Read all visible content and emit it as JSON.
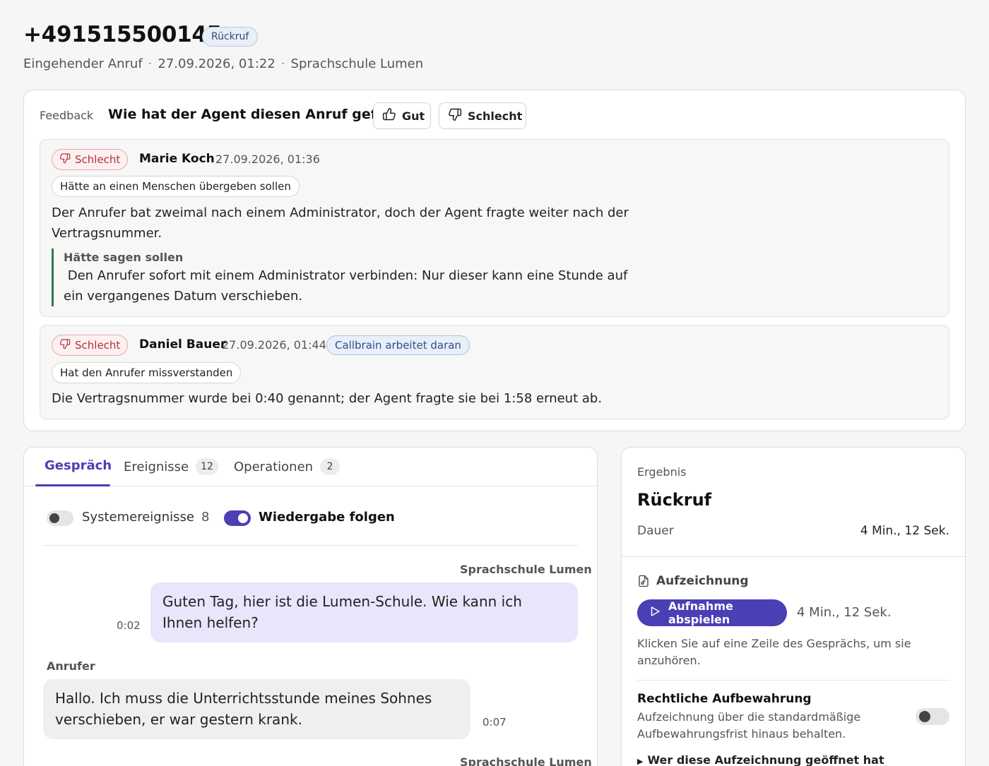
{
  "header": {
    "phone": "+491515500145",
    "badge": "Rückruf",
    "direction": "Eingehender Anruf",
    "datetime": "27.09.2026, 01:22",
    "org": "Sprachschule Lumen"
  },
  "feedback": {
    "label": "Feedback",
    "question": "Wie hat der Agent diesen Anruf geführt?",
    "good_label": "Gut",
    "bad_label": "Schlecht",
    "entries": [
      {
        "rating": "Schlecht",
        "author": "Marie Koch",
        "timestamp": "27.09.2026, 01:36",
        "tag": "Hätte an einen Menschen übergeben sollen",
        "text": "Der Anrufer bat zweimal nach einem Administrator, doch der Agent fragte weiter nach der Vertragsnummer.",
        "should_have_label": "Hätte sagen sollen",
        "should_have_text": " Den Anrufer sofort mit einem Administrator verbinden: Nur dieser kann eine Stunde auf ein vergangenes Datum verschieben."
      },
      {
        "rating": "Schlecht",
        "author": "Daniel Bauer",
        "timestamp": "27.09.2026, 01:44",
        "status": "Callbrain arbeitet daran",
        "tag": "Hat den Anrufer missverstanden",
        "text": "Die Vertragsnummer wurde bei 0:40 genannt; der Agent fragte sie bei 1:58 erneut ab."
      }
    ]
  },
  "conversation": {
    "tabs": [
      {
        "label": "Gespräch",
        "count": ""
      },
      {
        "label": "Ereignisse",
        "count": "12"
      },
      {
        "label": "Operationen",
        "count": "2"
      }
    ],
    "system_events_label": "Systemereignisse",
    "system_events_count": "8",
    "system_events_on": false,
    "follow_playback_label": "Wiedergabe folgen",
    "follow_playback_on": true,
    "messages": [
      {
        "speaker": "Sprachschule Lumen",
        "time": "0:02",
        "text": "Guten Tag, hier ist die Lumen-Schule. Wie kann ich Ihnen helfen?"
      },
      {
        "speaker": "Anrufer",
        "time": "0:07",
        "text": "Hallo. Ich muss die Unterrichtsstunde meines Sohnes verschieben, er war gestern krank."
      },
      {
        "speaker": "Sprachschule Lumen"
      }
    ]
  },
  "result": {
    "label": "Ergebnis",
    "title": "Rückruf",
    "duration_label": "Dauer",
    "duration_value": "4 Min., 12 Sek.",
    "recording_label": "Aufzeichnung",
    "play_label": "Aufnahme abspielen",
    "recording_length": "4 Min., 12 Sek.",
    "hint": "Klicken Sie auf eine Zeile des Gesprächs, um sie anzuhören.",
    "legal_title": "Rechtliche Aufbewahrung",
    "legal_desc": "Aufzeichnung über die standardmäßige Aufbewahrungsfrist hinaus behalten.",
    "legal_on": false,
    "details_label": "Wer diese Aufzeichnung geöffnet hat"
  },
  "colors": {
    "accent": "#4a3fb5",
    "bad": "#b2323a",
    "quote_bar": "#2f7a55"
  }
}
